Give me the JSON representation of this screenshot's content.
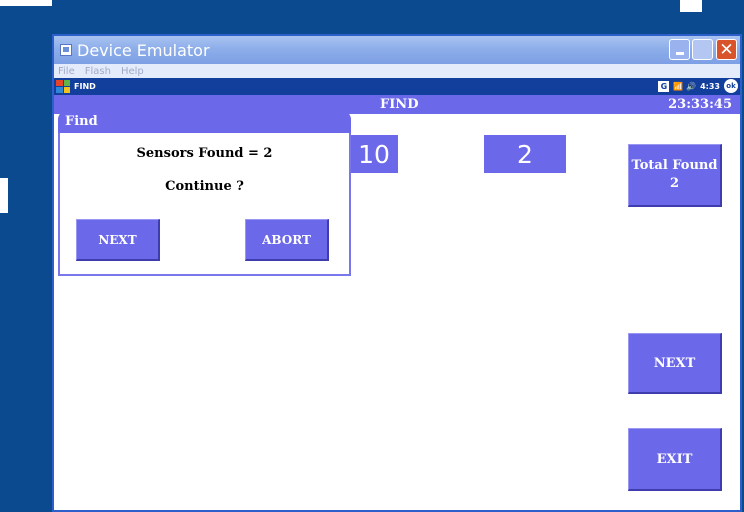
{
  "window": {
    "title": "Device Emulator",
    "menu": [
      "File",
      "Flash",
      "Help"
    ]
  },
  "pda_status": {
    "app_name": "FIND",
    "tray_g": "G",
    "tray_icons": "📶 🔊",
    "time": "4:33",
    "ok": "ok"
  },
  "app": {
    "title": "FIND",
    "clock": "23:33:45",
    "counter_left": "10",
    "counter_right": "2",
    "total_found_label": "Total Found",
    "total_found_value": "2",
    "next_label": "NEXT",
    "exit_label": "EXIT"
  },
  "dialog": {
    "title": "Find",
    "message": "Sensors Found = 2",
    "question": "Continue ?",
    "next_label": "NEXT",
    "abort_label": "ABORT"
  },
  "colors": {
    "desktop": "#0b4a8f",
    "app_accent": "#6c68ea",
    "status_bar": "#123f9c"
  }
}
